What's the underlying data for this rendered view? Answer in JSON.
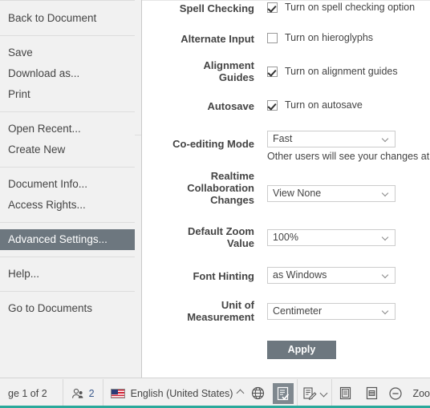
{
  "sidebar": {
    "groups": [
      {
        "items": [
          {
            "label": "Back to Document",
            "selected": false,
            "name": "back-to-document"
          }
        ]
      },
      {
        "items": [
          {
            "label": "Save",
            "selected": false,
            "name": "save"
          },
          {
            "label": "Download as...",
            "selected": false,
            "name": "download-as"
          },
          {
            "label": "Print",
            "selected": false,
            "name": "print"
          }
        ]
      },
      {
        "items": [
          {
            "label": "Open Recent...",
            "selected": false,
            "name": "open-recent"
          },
          {
            "label": "Create New",
            "selected": false,
            "name": "create-new"
          }
        ]
      },
      {
        "items": [
          {
            "label": "Document Info...",
            "selected": false,
            "name": "document-info"
          },
          {
            "label": "Access Rights...",
            "selected": false,
            "name": "access-rights"
          }
        ]
      },
      {
        "items": [
          {
            "label": "Advanced Settings...",
            "selected": true,
            "name": "advanced-settings"
          }
        ]
      },
      {
        "items": [
          {
            "label": "Help...",
            "selected": false,
            "name": "help"
          }
        ]
      },
      {
        "items": [
          {
            "label": "Go to Documents",
            "selected": false,
            "name": "go-to-documents"
          }
        ]
      }
    ]
  },
  "settings": {
    "rows": [
      {
        "label": "Spell Checking",
        "caption": "Turn on spell checking option",
        "checked": true
      },
      {
        "label": "Alternate Input",
        "caption": "Turn on hieroglyphs",
        "checked": false
      },
      {
        "label": "Alignment\nGuides",
        "caption": "Turn on alignment guides",
        "checked": true
      },
      {
        "label": "Autosave",
        "caption": "Turn on autosave",
        "checked": true
      }
    ],
    "coediting": {
      "label": "Co-editing Mode",
      "value": "Fast",
      "hint": "Other users will see your changes at once"
    },
    "realtime": {
      "label": "Realtime\nCollaboration\nChanges",
      "value": "View None"
    },
    "zoom": {
      "label": "Default Zoom\nValue",
      "value": "100%"
    },
    "hinting": {
      "label": "Font Hinting",
      "value": "as Windows"
    },
    "units": {
      "label": "Unit of\nMeasurement",
      "value": "Centimeter"
    },
    "apply_label": "Apply"
  },
  "statusbar": {
    "page_label": "ge 1 of 2",
    "people_count": "2",
    "language": "English (United States)",
    "zoom_label": "Zoo"
  },
  "colors": {
    "accent": "#2aa99b",
    "selected_bg": "#6d777f",
    "panel_bg": "#ffffff",
    "sidebar_bg": "#f1f1f1"
  }
}
